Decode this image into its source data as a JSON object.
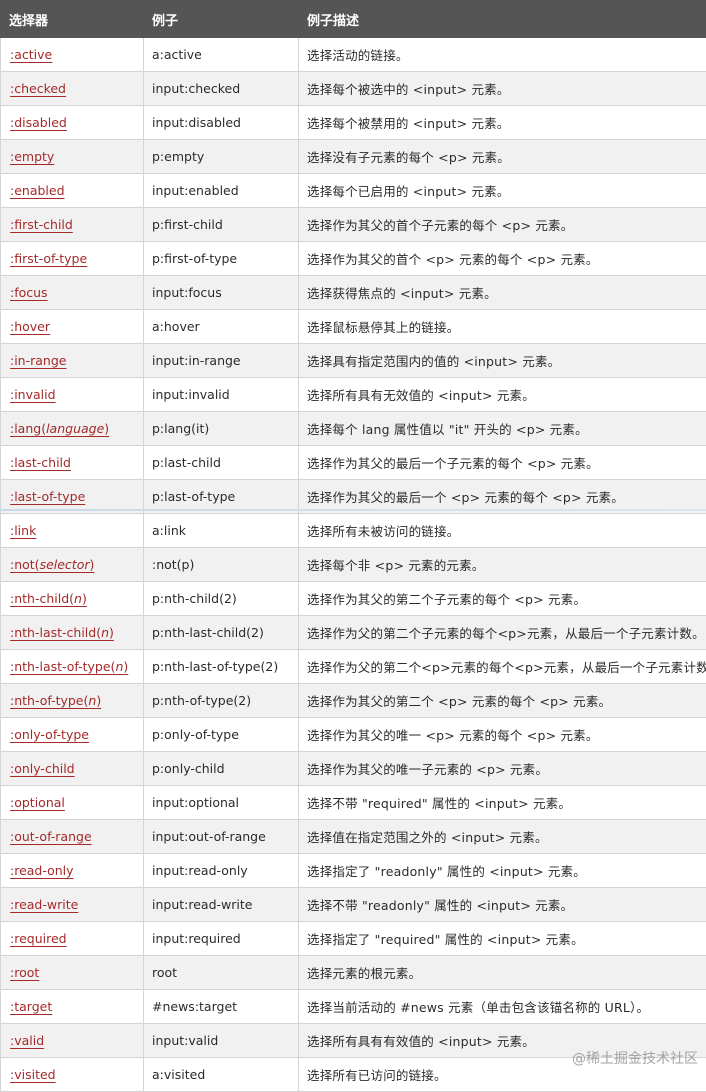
{
  "header": {
    "col1": "选择器",
    "col2": "例子",
    "col3": "例子描述"
  },
  "rows": [
    {
      "sel": ":active",
      "arg": "",
      "example": "a:active",
      "desc": "选择活动的链接。"
    },
    {
      "sel": ":checked",
      "arg": "",
      "example": "input:checked",
      "desc": "选择每个被选中的 <input> 元素。"
    },
    {
      "sel": ":disabled",
      "arg": "",
      "example": "input:disabled",
      "desc": "选择每个被禁用的 <input> 元素。"
    },
    {
      "sel": ":empty",
      "arg": "",
      "example": "p:empty",
      "desc": "选择没有子元素的每个 <p> 元素。"
    },
    {
      "sel": ":enabled",
      "arg": "",
      "example": "input:enabled",
      "desc": "选择每个已启用的 <input> 元素。"
    },
    {
      "sel": ":first-child",
      "arg": "",
      "example": "p:first-child",
      "desc": "选择作为其父的首个子元素的每个 <p> 元素。"
    },
    {
      "sel": ":first-of-type",
      "arg": "",
      "example": "p:first-of-type",
      "desc": "选择作为其父的首个 <p> 元素的每个 <p> 元素。"
    },
    {
      "sel": ":focus",
      "arg": "",
      "example": "input:focus",
      "desc": "选择获得焦点的 <input> 元素。"
    },
    {
      "sel": ":hover",
      "arg": "",
      "example": "a:hover",
      "desc": "选择鼠标悬停其上的链接。"
    },
    {
      "sel": ":in-range",
      "arg": "",
      "example": "input:in-range",
      "desc": "选择具有指定范围内的值的 <input> 元素。"
    },
    {
      "sel": ":invalid",
      "arg": "",
      "example": "input:invalid",
      "desc": "选择所有具有无效值的 <input> 元素。"
    },
    {
      "sel": ":lang(",
      "arg": "language",
      "close": ")",
      "example": "p:lang(it)",
      "desc": "选择每个 lang 属性值以 \"it\" 开头的 <p> 元素。"
    },
    {
      "sel": ":last-child",
      "arg": "",
      "example": "p:last-child",
      "desc": "选择作为其父的最后一个子元素的每个 <p> 元素。"
    },
    {
      "sel": ":last-of-type",
      "arg": "",
      "example": "p:last-of-type",
      "desc": "选择作为其父的最后一个 <p> 元素的每个 <p> 元素。"
    },
    {
      "sel": ":link",
      "arg": "",
      "example": "a:link",
      "desc": "选择所有未被访问的链接。"
    },
    {
      "sel": ":not(",
      "arg": "selector",
      "close": ")",
      "example": ":not(p)",
      "desc": "选择每个非 <p> 元素的元素。"
    },
    {
      "sel": ":nth-child(",
      "arg": "n",
      "close": ")",
      "example": "p:nth-child(2)",
      "desc": "选择作为其父的第二个子元素的每个 <p> 元素。"
    },
    {
      "sel": ":nth-last-child(",
      "arg": "n",
      "close": ")",
      "example": "p:nth-last-child(2)",
      "desc": "选择作为父的第二个子元素的每个<p>元素，从最后一个子元素计数。"
    },
    {
      "sel": ":nth-last-of-type(",
      "arg": "n",
      "close": ")",
      "example": "p:nth-last-of-type(2)",
      "desc": "选择作为父的第二个<p>元素的每个<p>元素，从最后一个子元素计数"
    },
    {
      "sel": ":nth-of-type(",
      "arg": "n",
      "close": ")",
      "example": "p:nth-of-type(2)",
      "desc": "选择作为其父的第二个 <p> 元素的每个 <p> 元素。"
    },
    {
      "sel": ":only-of-type",
      "arg": "",
      "example": "p:only-of-type",
      "desc": "选择作为其父的唯一 <p> 元素的每个 <p> 元素。"
    },
    {
      "sel": ":only-child",
      "arg": "",
      "example": "p:only-child",
      "desc": "选择作为其父的唯一子元素的 <p> 元素。"
    },
    {
      "sel": ":optional",
      "arg": "",
      "example": "input:optional",
      "desc": "选择不带 \"required\" 属性的 <input> 元素。"
    },
    {
      "sel": ":out-of-range",
      "arg": "",
      "example": "input:out-of-range",
      "desc": "选择值在指定范围之外的 <input> 元素。"
    },
    {
      "sel": ":read-only",
      "arg": "",
      "example": "input:read-only",
      "desc": "选择指定了 \"readonly\" 属性的 <input> 元素。"
    },
    {
      "sel": ":read-write",
      "arg": "",
      "example": "input:read-write",
      "desc": "选择不带 \"readonly\" 属性的 <input> 元素。"
    },
    {
      "sel": ":required",
      "arg": "",
      "example": "input:required",
      "desc": "选择指定了 \"required\" 属性的 <input> 元素。"
    },
    {
      "sel": ":root",
      "arg": "",
      "example": "root",
      "desc": "选择元素的根元素。"
    },
    {
      "sel": ":target",
      "arg": "",
      "example": "#news:target",
      "desc": "选择当前活动的 #news 元素（单击包含该锚名称的 URL）。"
    },
    {
      "sel": ":valid",
      "arg": "",
      "example": "input:valid",
      "desc": "选择所有具有有效值的 <input> 元素。"
    },
    {
      "sel": ":visited",
      "arg": "",
      "example": "a:visited",
      "desc": "选择所有已访问的链接。"
    }
  ],
  "watermark": "@稀土掘金技术社区",
  "colors": {
    "header_bg": "#555555",
    "link": "#a52a2a",
    "stripe": "#f1f1f1"
  }
}
